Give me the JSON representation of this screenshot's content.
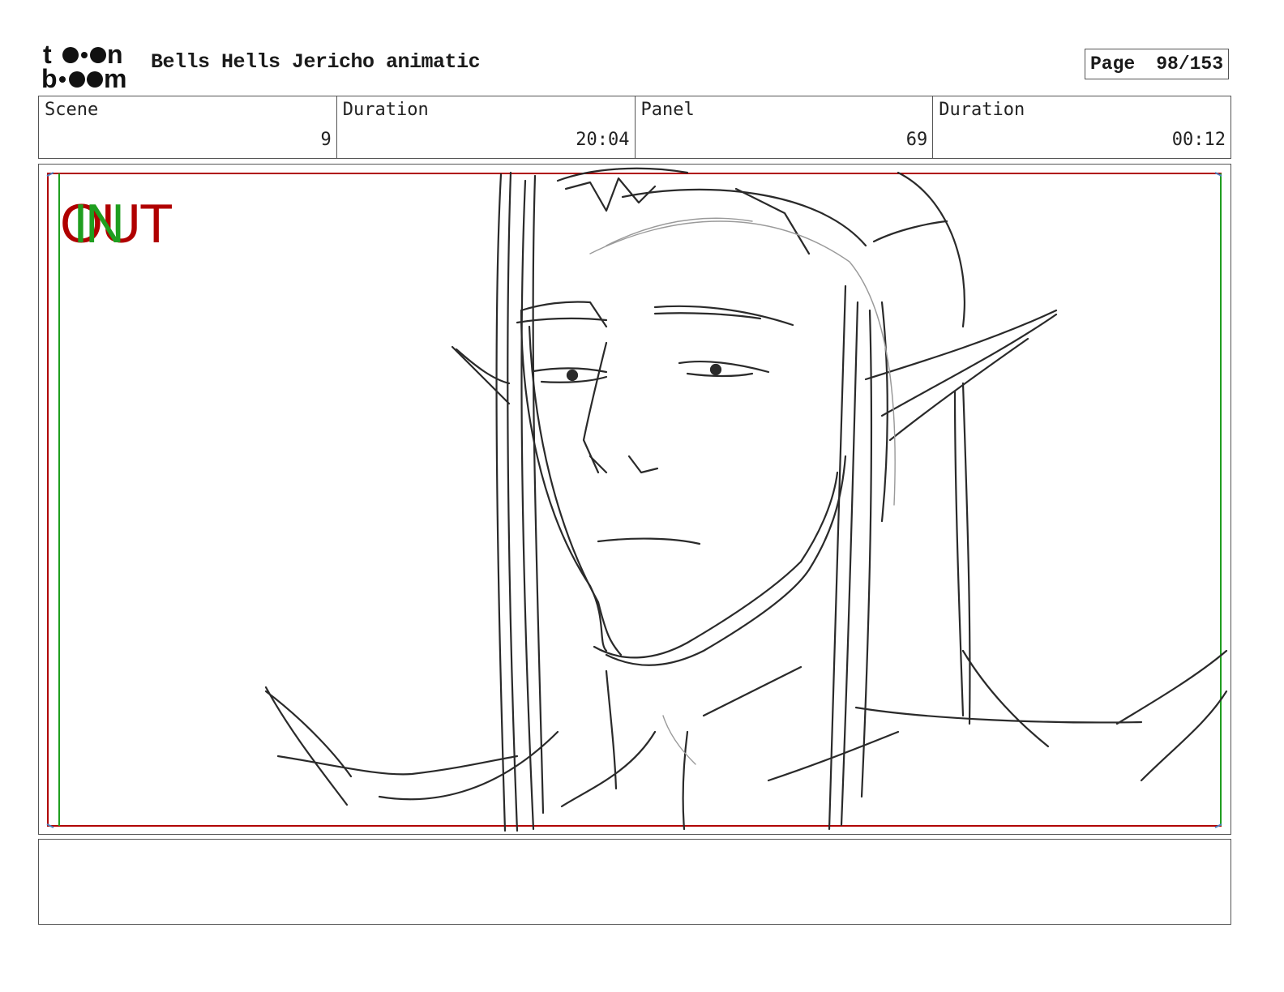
{
  "logo": {
    "line1": "toon",
    "line2": "boom"
  },
  "header": {
    "title": "Bells Hells Jericho animatic",
    "page_label": "Page",
    "page_value": "98/153"
  },
  "info": {
    "scene_label": "Scene",
    "scene_value": "9",
    "scene_duration_label": "Duration",
    "scene_duration_value": "20:04",
    "panel_label": "Panel",
    "panel_value": "69",
    "panel_duration_label": "Duration",
    "panel_duration_value": "00:12"
  },
  "panel": {
    "in_label": "IN",
    "out_label": "OUT",
    "in_color": "#1f9e1f",
    "out_color": "#b00000",
    "sketch": "rough pencil sketch of a long-haired elf with pointed ears looking down"
  },
  "dialogue": {
    "text": ""
  }
}
